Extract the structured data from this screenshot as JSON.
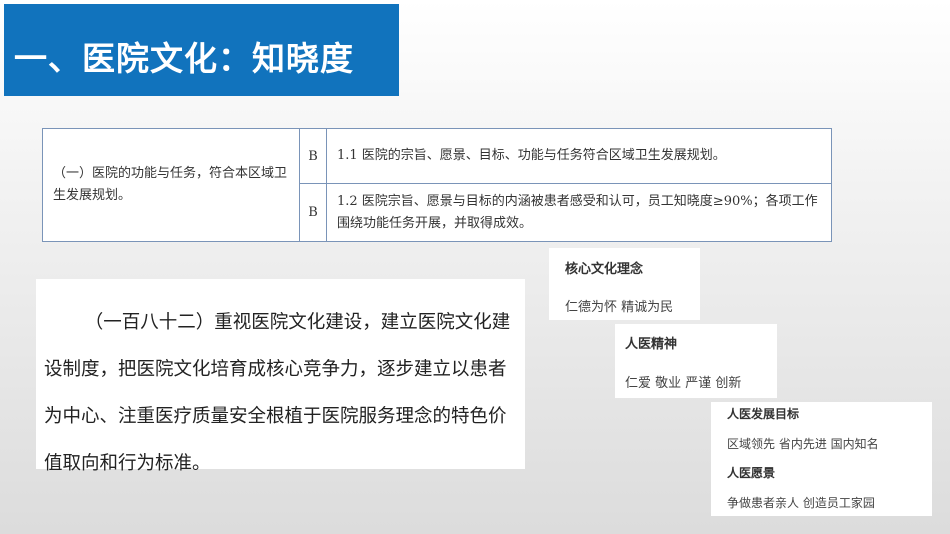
{
  "header": {
    "title": "一、医院文化：知晓度"
  },
  "table": {
    "category": "（一）医院的功能与任务，符合本区域卫生发展规划。",
    "rows": [
      {
        "grade": "B",
        "text": "1.1 医院的宗旨、愿景、目标、功能与任务符合区域卫生发展规划。"
      },
      {
        "grade": "B",
        "text": "1.2 医院宗旨、愿景与目标的内涵被患者感受和认可，员工知晓度≥90%；各项工作围绕功能任务开展，并取得成效。"
      }
    ]
  },
  "quote": {
    "text": "（一百八十二）重视医院文化建设，建立医院文化建设制度，把医院文化培育成核心竞争力，逐步建立以患者为中心、注重医疗质量安全根植于医院服务理念的特色价值取向和行为标准。"
  },
  "cards": {
    "core": {
      "title": "核心文化理念",
      "text": "仁德为怀 精诚为民"
    },
    "spirit": {
      "title": "人医精神",
      "text": "仁爱 敬业 严谨 创新"
    },
    "goal": {
      "title": "人医发展目标",
      "text": "区域领先 省内先进 国内知名"
    },
    "vision": {
      "title": "人医愿景",
      "text": "争做患者亲人 创造员工家园"
    }
  }
}
